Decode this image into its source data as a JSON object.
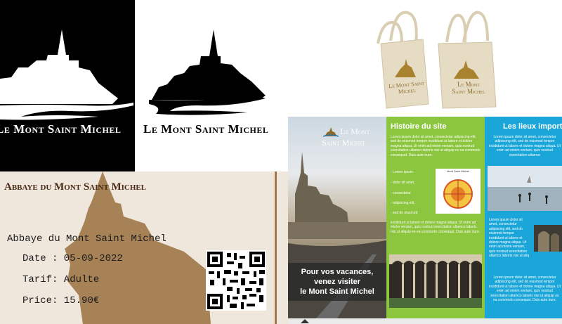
{
  "logo": {
    "dark_text": "Le Mont Saint Michel",
    "light_text": "Le Mont Saint Michel"
  },
  "bags": {
    "left_label_line1": "Le Mont Saint Michel",
    "right_label_line1": "Le Mont",
    "right_label_line2": "Saint Michel"
  },
  "ticket": {
    "header": "Abbaye du Mont Saint Michel",
    "name_line": "Abbaye du Mont Saint Michel",
    "date_line": "Date : 05-09-2022",
    "tarif_line": "Tarif: Adulte",
    "price_line": "Price: 15.90€"
  },
  "brochure": {
    "logo_line1": "Le Mont",
    "logo_line2": "Saint Michel",
    "cta_line1": "Pour vos vacances,",
    "cta_line2": "venez visiter",
    "cta_line3": "le Mont Saint Michel",
    "histoire_title": "Histoire du site",
    "histoire_p1": "Lorem ipsum dolor sit amet, consectetur adipiscing elit, sed do eiusmod tempor incididunt ut labore et dolore magna aliqua. Ut enim ad minim veniam, quis nostrud exercitation ullamco laboris nisi ut aliquip ex ea commodo consequat. Duis aute irure.",
    "bullets": [
      "- Lorem ipsum",
      "- dolor sit amet,",
      "- consectetur",
      "- adipiscing elit,",
      "- sed do eiusmod"
    ],
    "map_title": "Mont Saint Michel",
    "histoire_p2": "incididunt ut labore et dolore magna aliqua. Ut enim ad minim veniam, quis nostrud exercitation ullamco laboris nisi ut aliquip ex ea commodo consequat. Duis aute irure.",
    "lieux_title": "Les lieux importa",
    "lieux_p1": "Lorem ipsum dolor sit amet, consectetur adipiscing elit, sed do eiusmod tempor incididunt ut labore et dolore magna aliqua. Ut enim ad minim veniam, quis nostrud exercitation ullamco",
    "lieux_p2": "Lorem ipsum dolor sit amet, consectetur adipiscing elit, sed do eiusmod tempor incididunt ut labore et dolore magna aliqua. Ut enim ad minim veniam, quis nostrud exercitation ullamco laboris nisi ut aliq",
    "lieux_p3": "Lorem ipsum dolor sit amet, consectetur adipiscing elit, sed do eiusmod tempor incididunt ut labore et dolore magna aliqua. Ut enim ad minim veniam, quis nostrud exercitation ullamco laboris nisi ut aliquip ex ea commodo consequat. Duis aute irure."
  },
  "colors": {
    "ticket_bg": "#efe6dc",
    "ticket_silhouette": "#a78256",
    "brochure_green": "#8cc63f",
    "brochure_blue": "#1aa6d8",
    "bag_canvas": "#e6dcc4"
  }
}
